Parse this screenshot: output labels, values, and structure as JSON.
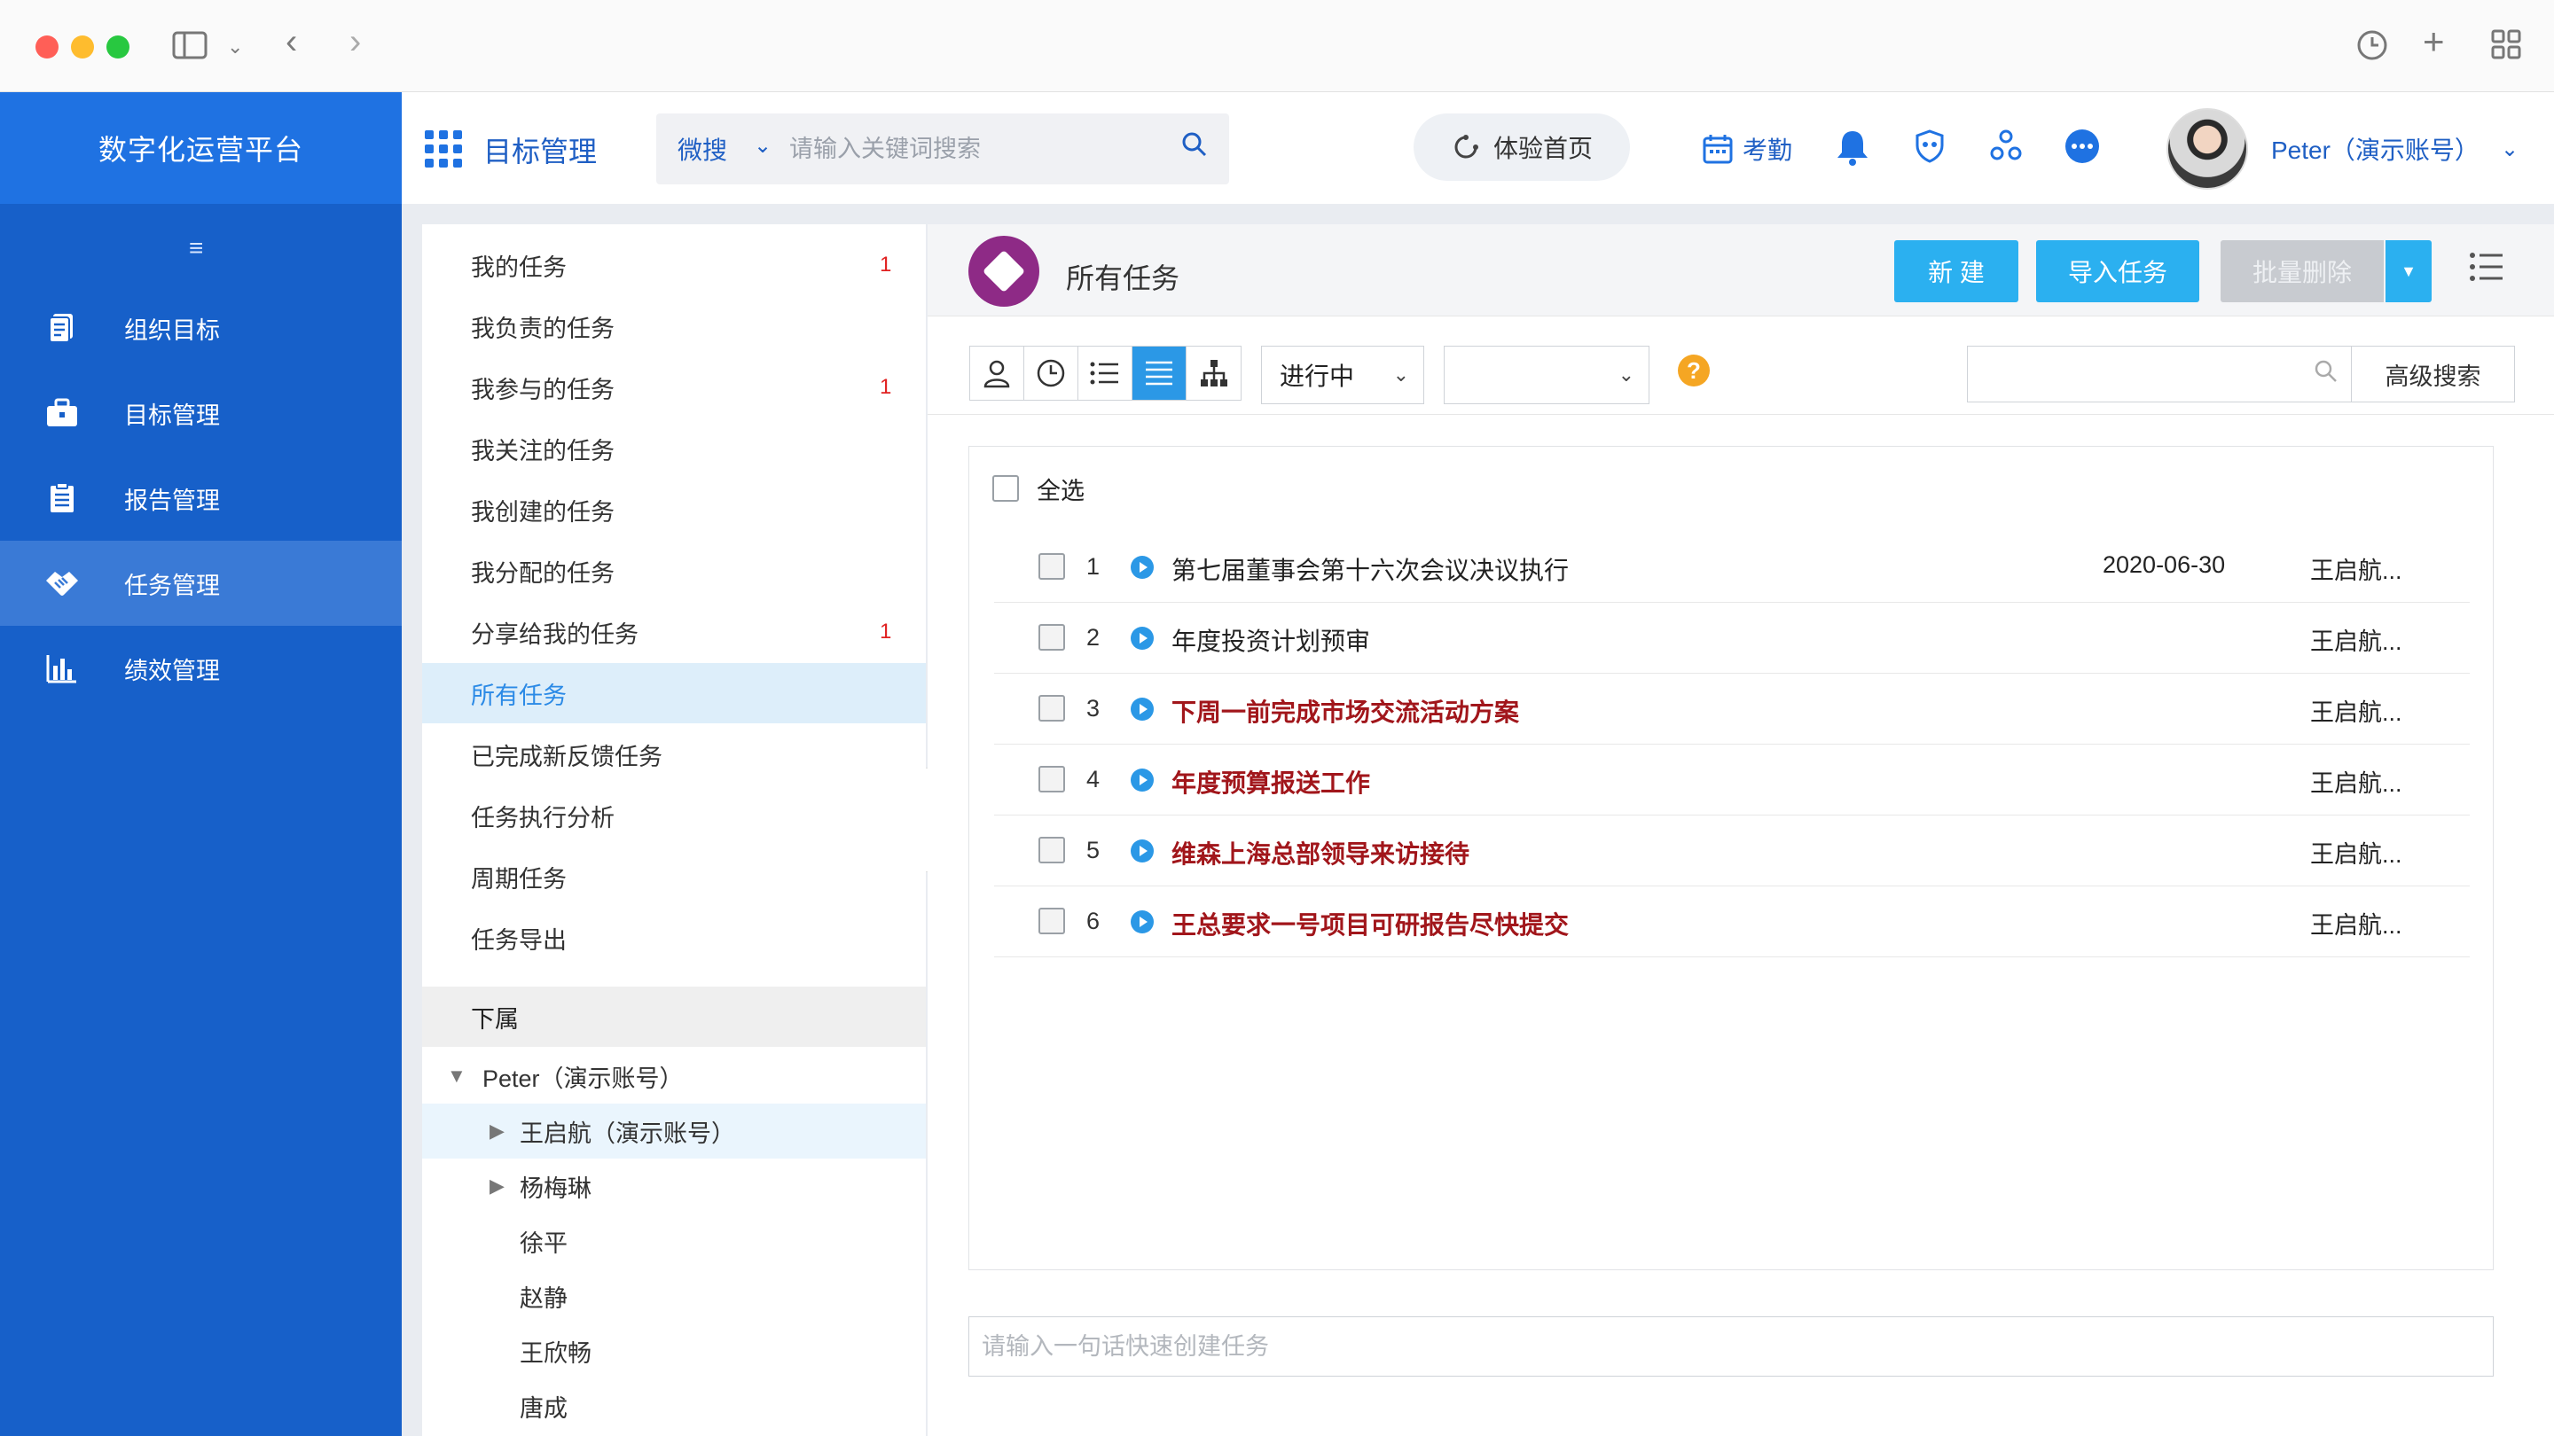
{
  "window": {
    "traffic_colors": [
      "#ff5f57",
      "#febc2e",
      "#28c840"
    ]
  },
  "sidebar": {
    "brand": "数字化运营平台",
    "items": [
      {
        "label": "组织目标",
        "icon": "clipboard-icon"
      },
      {
        "label": "目标管理",
        "icon": "briefcase-icon"
      },
      {
        "label": "报告管理",
        "icon": "report-icon"
      },
      {
        "label": "任务管理",
        "icon": "handshake-icon",
        "active": true
      },
      {
        "label": "绩效管理",
        "icon": "bar-chart-icon"
      }
    ]
  },
  "header": {
    "module_title": "目标管理",
    "search_scope": "微搜",
    "search_placeholder": "请输入关键词搜索",
    "experience_home": "体验首页",
    "attendance": "考勤",
    "user_name": "Peter（演示账号）"
  },
  "tasklist": {
    "items": [
      {
        "label": "我的任务",
        "count": "1"
      },
      {
        "label": "我负责的任务",
        "count": ""
      },
      {
        "label": "我参与的任务",
        "count": "1"
      },
      {
        "label": "我关注的任务",
        "count": ""
      },
      {
        "label": "我创建的任务",
        "count": ""
      },
      {
        "label": "我分配的任务",
        "count": ""
      },
      {
        "label": "分享给我的任务",
        "count": "1"
      },
      {
        "label": "所有任务",
        "count": "",
        "active": true
      },
      {
        "label": "已完成新反馈任务",
        "count": ""
      },
      {
        "label": "任务执行分析",
        "count": ""
      },
      {
        "label": "周期任务",
        "count": ""
      },
      {
        "label": "任务导出",
        "count": ""
      }
    ],
    "subordinates_label": "下属",
    "tree": [
      {
        "label": "Peter（演示账号）",
        "level": 0,
        "expanded": true
      },
      {
        "label": "王启航（演示账号）",
        "level": 1,
        "expandable": true,
        "selected": true
      },
      {
        "label": "杨梅琳",
        "level": 1,
        "expandable": true
      },
      {
        "label": "徐平",
        "level": 1
      },
      {
        "label": "赵静",
        "level": 1
      },
      {
        "label": "王欣畅",
        "level": 1
      },
      {
        "label": "唐成",
        "level": 1
      }
    ]
  },
  "main": {
    "title": "所有任务",
    "buttons": {
      "new": "新 建",
      "import": "导入任务",
      "batch_delete": "批量删除"
    },
    "status_filter": "进行中",
    "second_filter": "",
    "advanced_search": "高级搜索",
    "select_all": "全选",
    "tasks": [
      {
        "num": "1",
        "title": "第七届董事会第十六次会议决议执行",
        "date": "2020-06-30",
        "owner": "王启航...",
        "urgent": false
      },
      {
        "num": "2",
        "title": "年度投资计划预审",
        "date": "",
        "owner": "王启航...",
        "urgent": false
      },
      {
        "num": "3",
        "title": "下周一前完成市场交流活动方案",
        "date": "",
        "owner": "王启航...",
        "urgent": true
      },
      {
        "num": "4",
        "title": "年度预算报送工作",
        "date": "",
        "owner": "王启航...",
        "urgent": true
      },
      {
        "num": "5",
        "title": "维森上海总部领导来访接待",
        "date": "",
        "owner": "王启航...",
        "urgent": true
      },
      {
        "num": "6",
        "title": "王总要求一号项目可研报告尽快提交",
        "date": "",
        "owner": "王启航...",
        "urgent": true
      }
    ],
    "quick_create_placeholder": "请输入一句话快速创建任务"
  }
}
